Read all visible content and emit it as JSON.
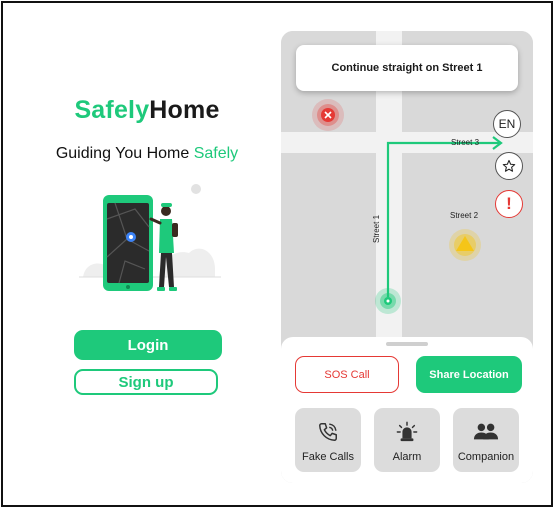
{
  "brand": {
    "part1": "Safely",
    "part2": "Home"
  },
  "tagline": {
    "prefix": "Guiding You Home ",
    "highlight": "Safely"
  },
  "auth": {
    "login_label": "Login",
    "signup_label": "Sign up"
  },
  "navigation": {
    "instruction": "Continue straight on Street 1"
  },
  "map": {
    "streets": [
      "Street 3",
      "Street 2",
      "Street 1"
    ],
    "language_label": "EN",
    "alert_glyph": "!"
  },
  "actions": {
    "sos_label": "SOS Call",
    "share_label": "Share Location",
    "tiles": [
      {
        "label": "Fake Calls",
        "icon": "phone-call-icon"
      },
      {
        "label": "Alarm",
        "icon": "siren-icon"
      },
      {
        "label": "Companion",
        "icon": "people-icon"
      }
    ]
  },
  "colors": {
    "accent": "#1ec97b",
    "danger": "#e53935",
    "warning": "#f5c518",
    "map": "#d9d9d9"
  }
}
